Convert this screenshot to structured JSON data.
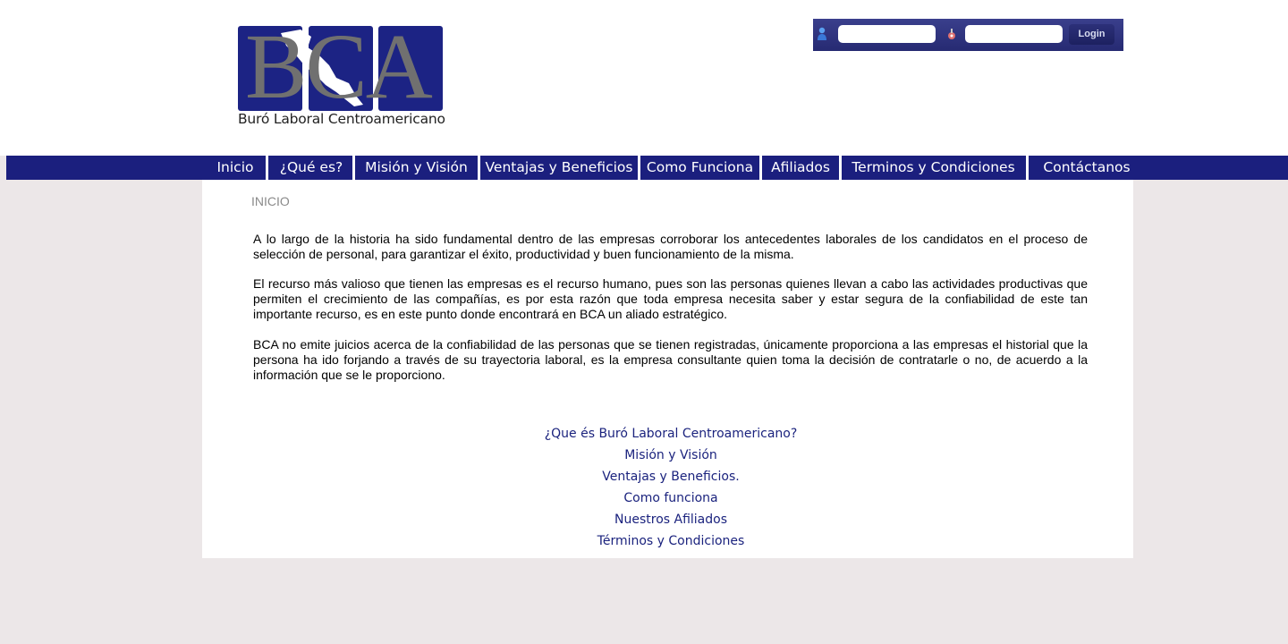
{
  "logo": {
    "letters": "BCA",
    "subtitle": "Buró Laboral Centroamericano"
  },
  "login": {
    "user_icon": "user-icon",
    "password_icon": "key-icon",
    "username_value": "",
    "password_value": "",
    "button_label": "Login"
  },
  "nav": {
    "items": [
      {
        "label": "Inicio"
      },
      {
        "label": "¿Qué es?"
      },
      {
        "label": "Misión y Visión"
      },
      {
        "label": "Ventajas y Beneficios"
      },
      {
        "label": "Como Funciona"
      },
      {
        "label": "Afiliados"
      },
      {
        "label": "Terminos y Condiciones"
      },
      {
        "label": "Contáctanos"
      }
    ]
  },
  "main": {
    "title": "INICIO",
    "paragraphs": [
      "A lo largo de la historia ha sido fundamental dentro de las empresas corroborar los antecedentes laborales de los candidatos en el proceso de selección de personal, para garantizar el éxito, productividad y buen funcionamiento de la misma.",
      "El recurso más valioso que tienen las empresas es el recurso humano, pues son las personas quienes llevan a cabo las actividades productivas que permiten el crecimiento de las compañías,  es por esta razón que toda empresa necesita saber y estar segura de la confiabilidad de este tan importante recurso, es en este punto donde encontrará en BCA un aliado estratégico.",
      "BCA no emite juicios acerca de la confiabilidad de las personas que se tienen registradas, únicamente proporciona a las empresas el historial que la persona ha ido forjando a través de su trayectoria laboral, es la empresa consultante quien toma la decisión de contratarle  o no, de acuerdo a la información que se le proporciono."
    ],
    "links": [
      {
        "label": "¿Que és Buró Laboral Centroamericano?"
      },
      {
        "label": "Misión y Visión"
      },
      {
        "label": "Ventajas y Beneficios."
      },
      {
        "label": "Como funciona"
      },
      {
        "label": "Nuestros Afiliados"
      },
      {
        "label": "Términos y Condiciones"
      }
    ]
  },
  "colors": {
    "brand_blue": "#1b1f7e",
    "page_background": "#ece7e8",
    "logo_gray": "#707070"
  }
}
